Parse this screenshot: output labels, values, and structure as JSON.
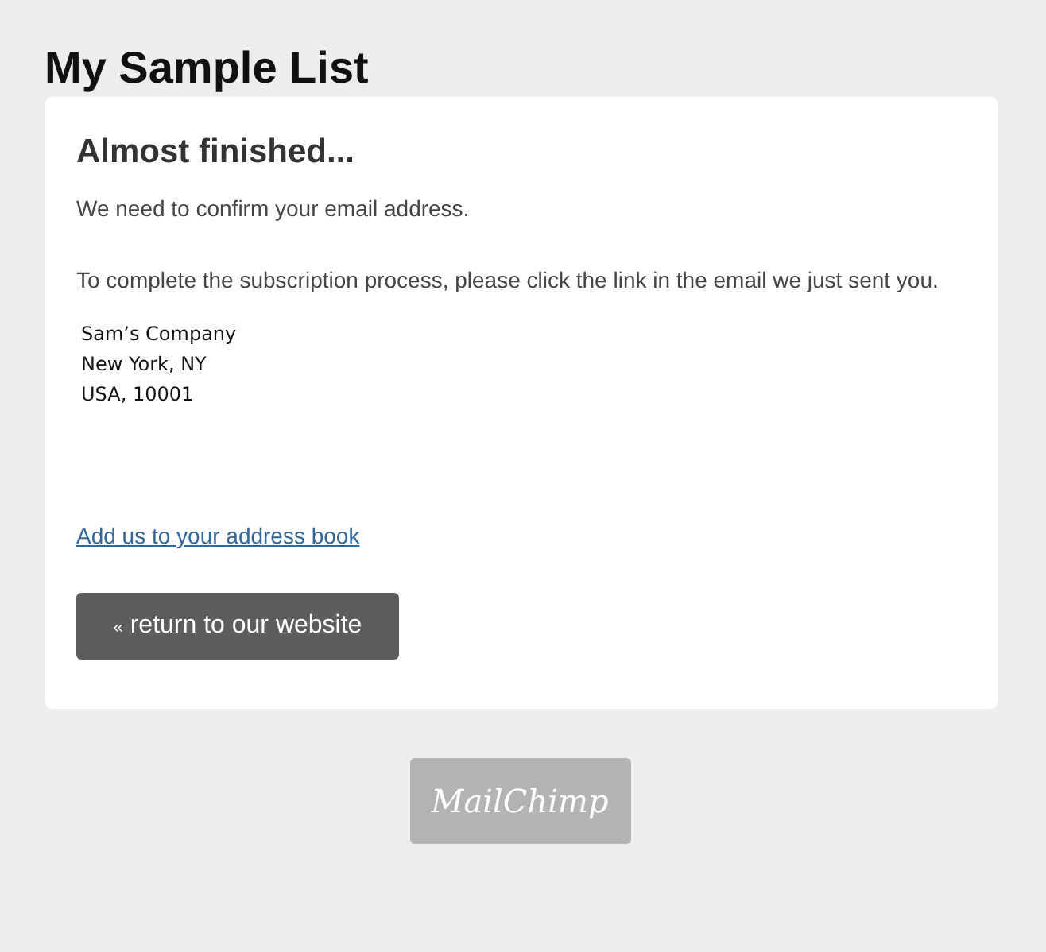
{
  "page_title": "My Sample List",
  "card": {
    "heading": "Almost finished...",
    "paragraphs": [
      "We need to confirm your email address.",
      "To complete the subscription process, please click the link in the email we just sent you."
    ],
    "address_lines": [
      "Sam’s Company",
      "New York, NY",
      "USA, 10001"
    ],
    "address_book_link": "Add us to your address book",
    "return_button": {
      "icon": "«",
      "label": "return to our website"
    }
  },
  "footer_logo": "MailChimp"
}
